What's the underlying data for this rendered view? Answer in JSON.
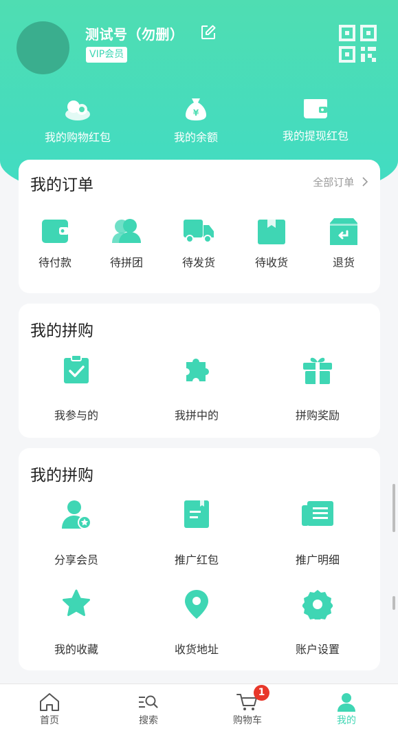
{
  "profile": {
    "username": "测试号（勿删）",
    "vip_label": "VIP会员"
  },
  "wallet": [
    {
      "label": "我的购物红包",
      "icon": "money-bag-coins-icon"
    },
    {
      "label": "我的余额",
      "icon": "yen-bag-icon"
    },
    {
      "label": "我的提现红包",
      "icon": "wallet-icon"
    }
  ],
  "orders": {
    "title": "我的订单",
    "all_label": "全部订单",
    "items": [
      {
        "label": "待付款",
        "icon": "wallet-icon"
      },
      {
        "label": "待拼团",
        "icon": "group-users-icon"
      },
      {
        "label": "待发货",
        "icon": "truck-icon"
      },
      {
        "label": "待收货",
        "icon": "box-icon"
      },
      {
        "label": "退货",
        "icon": "return-box-icon"
      }
    ]
  },
  "group_buy": {
    "title": "我的拼购",
    "items": [
      {
        "label": "我参与的",
        "icon": "clipboard-check-icon"
      },
      {
        "label": "我拼中的",
        "icon": "puzzle-icon"
      },
      {
        "label": "拼购奖励",
        "icon": "gift-icon"
      }
    ]
  },
  "services": {
    "title": "我的拼购",
    "items": [
      {
        "label": "分享会员",
        "icon": "user-star-icon"
      },
      {
        "label": "推广红包",
        "icon": "document-icon"
      },
      {
        "label": "推广明细",
        "icon": "newspaper-icon"
      },
      {
        "label": "我的收藏",
        "icon": "star-icon"
      },
      {
        "label": "收货地址",
        "icon": "location-pin-icon"
      },
      {
        "label": "账户设置",
        "icon": "settings-gear-icon"
      }
    ]
  },
  "tabbar": {
    "items": [
      {
        "label": "首页",
        "icon": "home-icon"
      },
      {
        "label": "搜索",
        "icon": "search-icon"
      },
      {
        "label": "购物车",
        "icon": "cart-icon"
      },
      {
        "label": "我的",
        "icon": "user-icon"
      }
    ],
    "cart_count": "1"
  },
  "colors": {
    "accent": "#3fd6b4",
    "header_top": "#4fddb2",
    "header_bottom": "#40dcc4",
    "badge": "#e8372a"
  }
}
